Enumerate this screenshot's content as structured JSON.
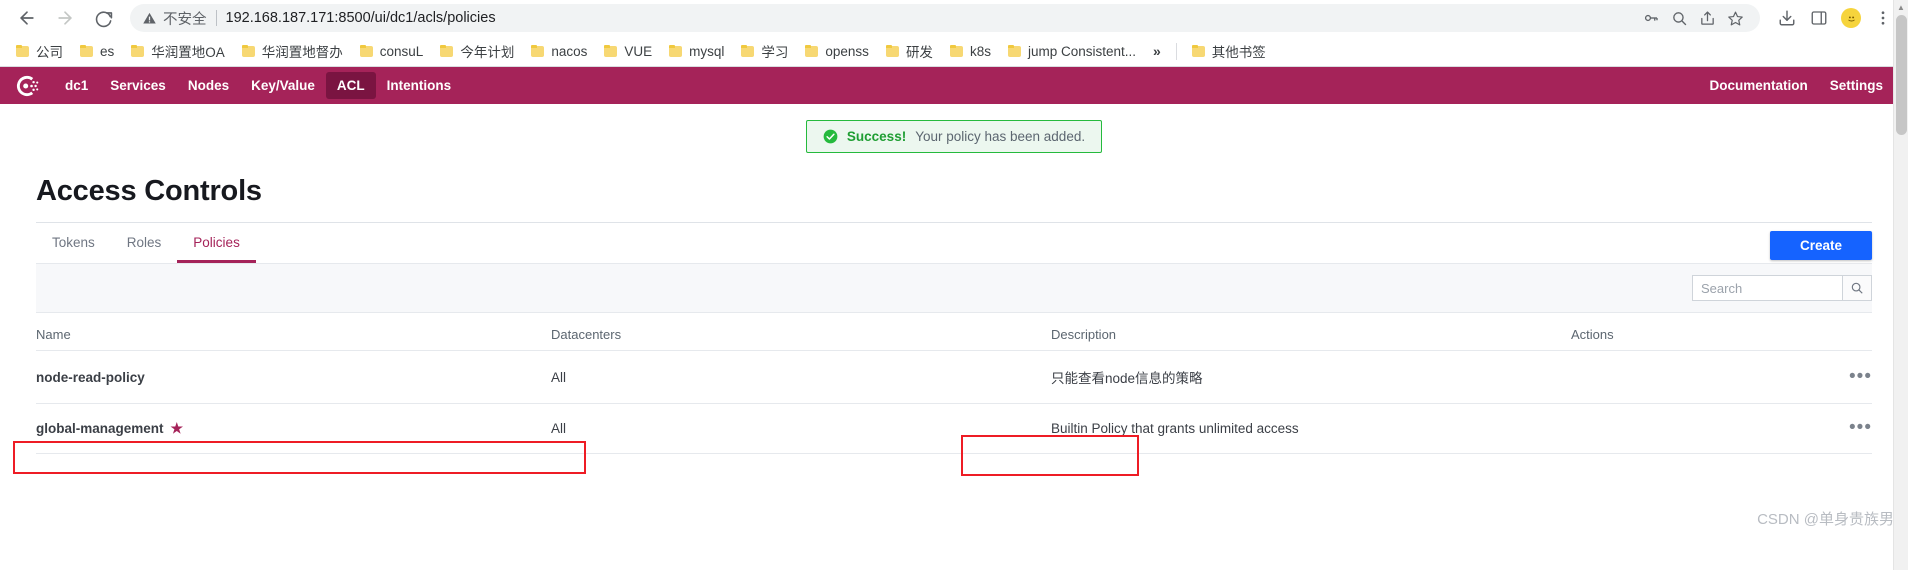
{
  "browser": {
    "back_label": "Back",
    "forward_label": "Forward",
    "reload_label": "Reload",
    "insecure_label": "不安全",
    "url": "192.168.187.171:8500/ui/dc1/acls/policies",
    "icons": {
      "warning": "warning-triangle-icon",
      "password_key": "password-key-icon",
      "search": "omnibox-search-icon",
      "share": "share-icon",
      "bookmark_star": "bookmark-star-icon",
      "download": "download-icon",
      "sidepanel": "side-panel-icon",
      "extension": "extension-icon",
      "menu": "three-dot-menu-icon"
    },
    "bookmarks": [
      {
        "label": "公司"
      },
      {
        "label": "es"
      },
      {
        "label": "华润置地OA"
      },
      {
        "label": "华润置地督办"
      },
      {
        "label": "consuL"
      },
      {
        "label": "今年计划"
      },
      {
        "label": "nacos"
      },
      {
        "label": "VUE"
      },
      {
        "label": "mysql"
      },
      {
        "label": "学习"
      },
      {
        "label": "openss"
      },
      {
        "label": "研发"
      },
      {
        "label": "k8s"
      },
      {
        "label": "jump Consistent..."
      }
    ],
    "bookmarks_overflow": "»",
    "other_bookmarks": "其他书签"
  },
  "consul_nav": {
    "logo_name": "consul-logo",
    "items": [
      {
        "label": "dc1",
        "active": false
      },
      {
        "label": "Services",
        "active": false
      },
      {
        "label": "Nodes",
        "active": false
      },
      {
        "label": "Key/Value",
        "active": false
      },
      {
        "label": "ACL",
        "active": true
      },
      {
        "label": "Intentions",
        "active": false
      }
    ],
    "right_items": [
      {
        "label": "Documentation"
      },
      {
        "label": "Settings"
      }
    ]
  },
  "toast": {
    "icon": "success-check-icon",
    "strong": "Success!",
    "message": "Your policy has been added.",
    "border_color": "#25ba3d",
    "background": "#ecf7ef"
  },
  "page": {
    "title": "Access Controls",
    "tabs": [
      {
        "label": "Tokens",
        "active": false
      },
      {
        "label": "Roles",
        "active": false
      },
      {
        "label": "Policies",
        "active": true
      }
    ],
    "create_label": "Create",
    "create_color": "#1563ff"
  },
  "search": {
    "placeholder": "Search",
    "value": "",
    "button_icon": "search-icon"
  },
  "table": {
    "headers": [
      "Name",
      "Datacenters",
      "Description",
      "Actions"
    ],
    "rows": [
      {
        "name": "node-read-policy",
        "starred": false,
        "datacenters": "All",
        "description": "只能查看node信息的策略",
        "actions": "•••"
      },
      {
        "name": "global-management",
        "starred": true,
        "star_glyph": "★",
        "datacenters": "All",
        "description": "Builtin Policy that grants unlimited access",
        "actions": "•••"
      }
    ]
  },
  "annotations": {
    "color": "#ee1c25",
    "boxes": [
      "name-cell-highlight",
      "description-cell-highlight"
    ]
  },
  "watermark": "CSDN @单身贵族男"
}
